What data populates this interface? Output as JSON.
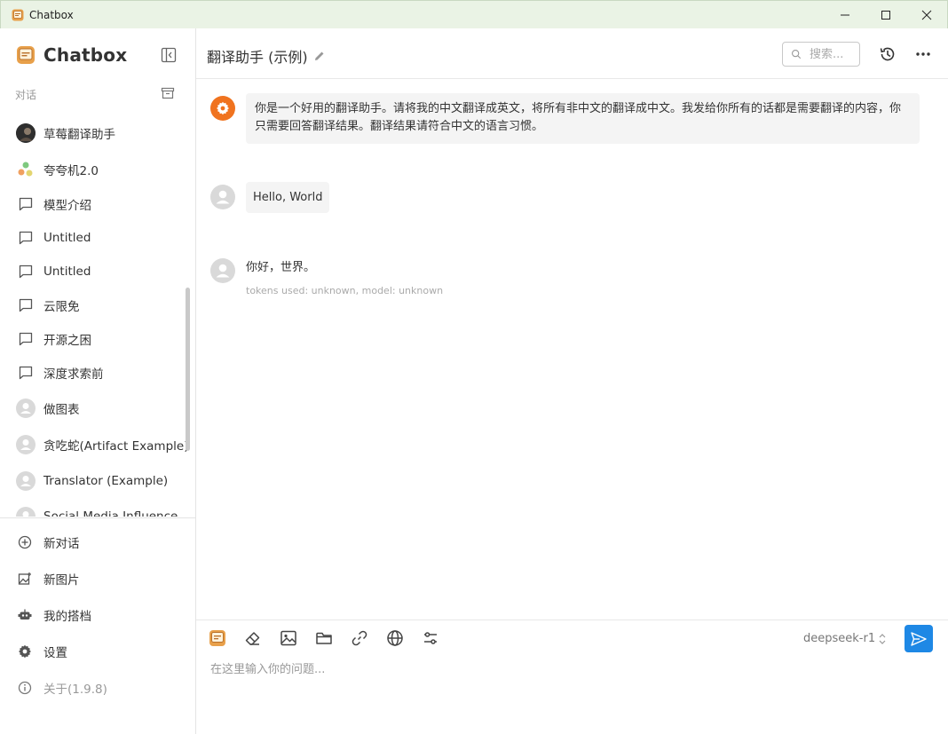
{
  "window": {
    "title": "Chatbox"
  },
  "sidebar": {
    "app_name": "Chatbox",
    "section_label": "对话",
    "sessions": [
      {
        "label": "草莓翻译助手",
        "icon": "photo-avatar"
      },
      {
        "label": "夸夸机2.0",
        "icon": "colorful-avatar"
      },
      {
        "label": "模型介绍",
        "icon": "chat-bubble-icon"
      },
      {
        "label": "Untitled",
        "icon": "chat-bubble-icon"
      },
      {
        "label": "Untitled",
        "icon": "chat-bubble-icon"
      },
      {
        "label": "云限免",
        "icon": "chat-bubble-icon"
      },
      {
        "label": "开源之困",
        "icon": "chat-bubble-icon"
      },
      {
        "label": "深度求索前",
        "icon": "chat-bubble-icon"
      },
      {
        "label": "做图表",
        "icon": "user-avatar"
      },
      {
        "label": "贪吃蛇(Artifact Example)",
        "icon": "user-avatar"
      },
      {
        "label": "Translator (Example)",
        "icon": "user-avatar"
      },
      {
        "label": "Social Media Influence",
        "icon": "user-avatar"
      }
    ],
    "bottom": {
      "new_chat": "新对话",
      "new_image": "新图片",
      "my_copilots": "我的搭档",
      "settings": "设置",
      "about": "关于(1.9.8)"
    }
  },
  "header": {
    "chat_title": "翻译助手 (示例)",
    "search_placeholder": "搜索..."
  },
  "messages": {
    "system": "你是一个好用的翻译助手。请将我的中文翻译成英文，将所有非中文的翻译成中文。我发给你所有的话都是需要翻译的内容，你只需要回答翻译结果。翻译结果请符合中文的语言习惯。",
    "user": "Hello, World",
    "assistant": "你好，世界。",
    "assistant_meta": "tokens used: unknown, model: unknown"
  },
  "composer": {
    "model": "deepseek-r1",
    "placeholder": "在这里输入你的问题..."
  },
  "colors": {
    "accent": "#1e88e5",
    "system_avatar": "#f0731f",
    "titlebar": "#eaf3e5"
  }
}
